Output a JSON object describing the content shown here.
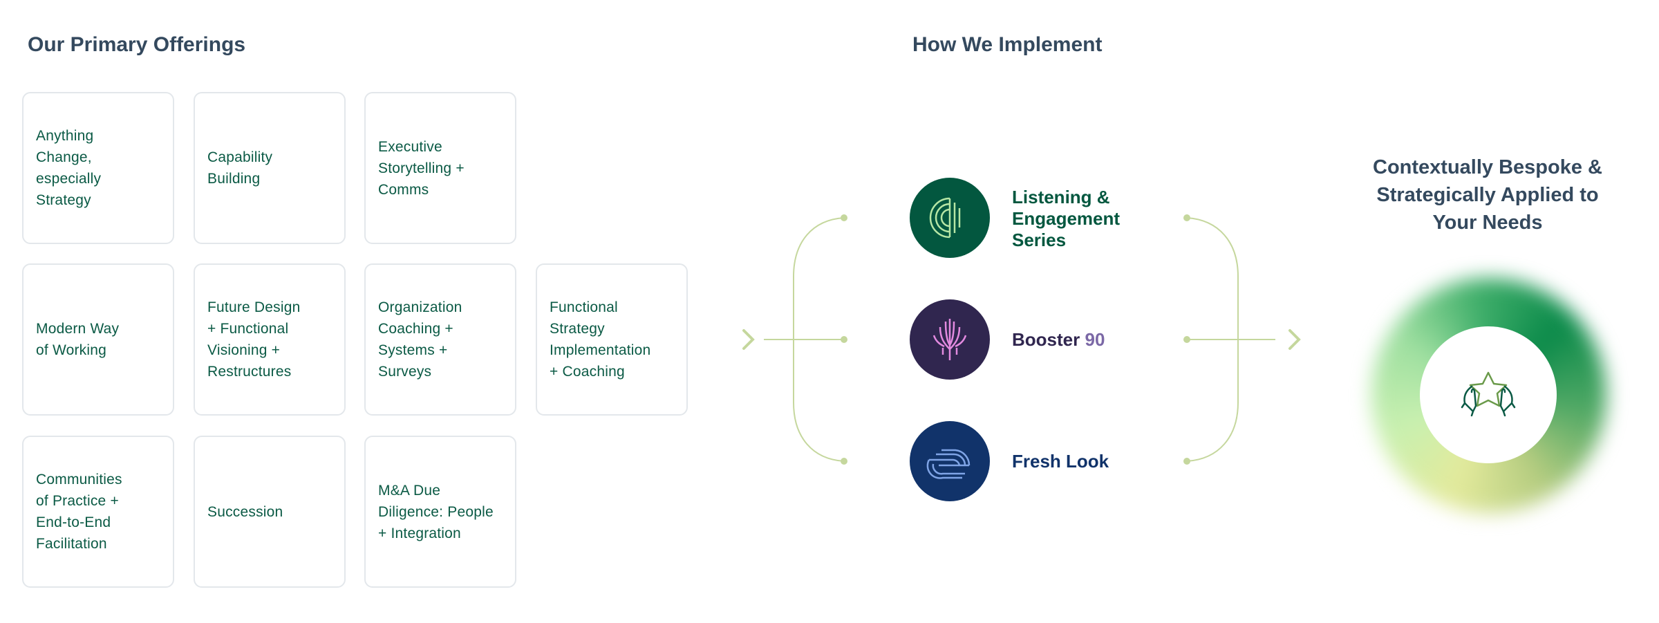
{
  "offerings": {
    "title": "Our Primary Offerings",
    "cards": [
      "Anything\nChange,\nespecially\nStrategy",
      "Capability\nBuilding",
      "Executive\nStorytelling +\nComms",
      "Modern Way\nof Working",
      "Future Design\n+ Functional\nVisioning +\nRestructures",
      "Organization\nCoaching +\nSystems +\nSurveys",
      "Functional\nStrategy\nImplementation\n+ Coaching",
      "Communities\nof Practice +\nEnd-to-End\nFacilitation",
      "Succession",
      "M&A Due\nDiligence: People\n+ Integration"
    ]
  },
  "implement": {
    "title": "How We Implement",
    "programs": [
      {
        "label": "Listening &\nEngagement\nSeries",
        "icon": "listening-waves-icon",
        "bg": "#03573f",
        "color": "#03573f"
      },
      {
        "label": "Booster",
        "label_suffix": "90",
        "icon": "booster-branches-icon",
        "bg": "#30264f",
        "color": "#30264f",
        "suffix_color": "#7b68a6"
      },
      {
        "label": "Fresh Look",
        "icon": "fresh-look-arcs-icon",
        "bg": "#11336a",
        "color": "#11336a"
      }
    ],
    "connector_color": "#c5d79d"
  },
  "outcome": {
    "title": "Contextually Bespoke &\nStrategically Applied to\nYour Needs",
    "icon": "hands-holding-star-icon"
  }
}
